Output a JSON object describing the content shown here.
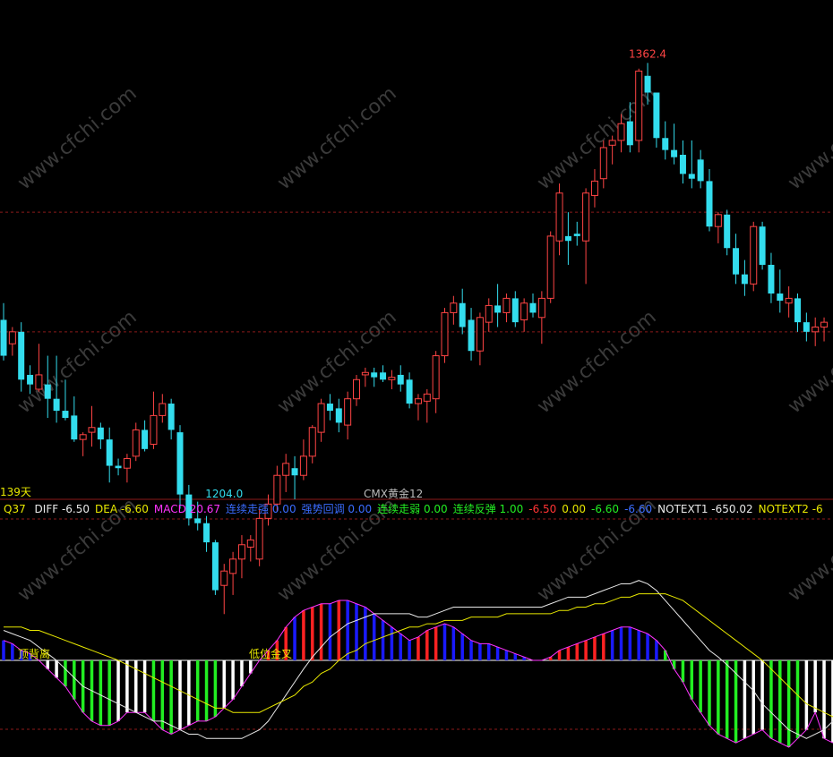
{
  "chart_data": {
    "type": "candlestick_macd",
    "instrument": "CMX黄金12",
    "days_label": "139天",
    "high_label": "1362.4",
    "low_label": "1204.0",
    "price_ylim": [
      1200,
      1370
    ],
    "price_gridlines": [
      1300,
      1250
    ],
    "candles": [
      {
        "o": 1255,
        "h": 1262,
        "l": 1238,
        "c": 1240
      },
      {
        "o": 1245,
        "h": 1252,
        "l": 1240,
        "c": 1250
      },
      {
        "o": 1250,
        "h": 1254,
        "l": 1225,
        "c": 1230
      },
      {
        "o": 1232,
        "h": 1236,
        "l": 1224,
        "c": 1228
      },
      {
        "o": 1226,
        "h": 1245,
        "l": 1225,
        "c": 1232
      },
      {
        "o": 1228,
        "h": 1240,
        "l": 1214,
        "c": 1222
      },
      {
        "o": 1222,
        "h": 1240,
        "l": 1212,
        "c": 1217
      },
      {
        "o": 1217,
        "h": 1230,
        "l": 1213,
        "c": 1214
      },
      {
        "o": 1215,
        "h": 1223,
        "l": 1204,
        "c": 1205
      },
      {
        "o": 1205,
        "h": 1208,
        "l": 1198,
        "c": 1207
      },
      {
        "o": 1208,
        "h": 1219,
        "l": 1202,
        "c": 1210
      },
      {
        "o": 1210,
        "h": 1212,
        "l": 1201,
        "c": 1205
      },
      {
        "o": 1205,
        "h": 1210,
        "l": 1187,
        "c": 1194
      },
      {
        "o": 1194,
        "h": 1197,
        "l": 1190,
        "c": 1193
      },
      {
        "o": 1193,
        "h": 1199,
        "l": 1187,
        "c": 1197
      },
      {
        "o": 1198,
        "h": 1212,
        "l": 1196,
        "c": 1209
      },
      {
        "o": 1209,
        "h": 1213,
        "l": 1200,
        "c": 1201
      },
      {
        "o": 1203,
        "h": 1225,
        "l": 1201,
        "c": 1215
      },
      {
        "o": 1215,
        "h": 1224,
        "l": 1212,
        "c": 1220
      },
      {
        "o": 1220,
        "h": 1222,
        "l": 1205,
        "c": 1209
      },
      {
        "o": 1208,
        "h": 1211,
        "l": 1176,
        "c": 1182
      },
      {
        "o": 1182,
        "h": 1186,
        "l": 1169,
        "c": 1172
      },
      {
        "o": 1172,
        "h": 1179,
        "l": 1167,
        "c": 1170
      },
      {
        "o": 1170,
        "h": 1173,
        "l": 1158,
        "c": 1162
      },
      {
        "o": 1162,
        "h": 1163,
        "l": 1140,
        "c": 1142
      },
      {
        "o": 1144,
        "h": 1153,
        "l": 1132,
        "c": 1150
      },
      {
        "o": 1149,
        "h": 1158,
        "l": 1140,
        "c": 1155
      },
      {
        "o": 1155,
        "h": 1165,
        "l": 1147,
        "c": 1161
      },
      {
        "o": 1160,
        "h": 1165,
        "l": 1154,
        "c": 1163
      },
      {
        "o": 1155,
        "h": 1176,
        "l": 1152,
        "c": 1172
      },
      {
        "o": 1172,
        "h": 1182,
        "l": 1169,
        "c": 1178
      },
      {
        "o": 1178,
        "h": 1194,
        "l": 1175,
        "c": 1190
      },
      {
        "o": 1190,
        "h": 1199,
        "l": 1183,
        "c": 1195
      },
      {
        "o": 1193,
        "h": 1198,
        "l": 1180,
        "c": 1190
      },
      {
        "o": 1190,
        "h": 1205,
        "l": 1188,
        "c": 1198
      },
      {
        "o": 1198,
        "h": 1211,
        "l": 1195,
        "c": 1210
      },
      {
        "o": 1208,
        "h": 1222,
        "l": 1204,
        "c": 1220
      },
      {
        "o": 1220,
        "h": 1224,
        "l": 1213,
        "c": 1217
      },
      {
        "o": 1218,
        "h": 1222,
        "l": 1208,
        "c": 1212
      },
      {
        "o": 1211,
        "h": 1225,
        "l": 1205,
        "c": 1222
      },
      {
        "o": 1222,
        "h": 1232,
        "l": 1219,
        "c": 1230
      },
      {
        "o": 1232,
        "h": 1235,
        "l": 1227,
        "c": 1233
      },
      {
        "o": 1233,
        "h": 1235,
        "l": 1227,
        "c": 1231
      },
      {
        "o": 1233,
        "h": 1236,
        "l": 1229,
        "c": 1230
      },
      {
        "o": 1230,
        "h": 1234,
        "l": 1226,
        "c": 1231
      },
      {
        "o": 1232,
        "h": 1236,
        "l": 1225,
        "c": 1228
      },
      {
        "o": 1230,
        "h": 1233,
        "l": 1218,
        "c": 1220
      },
      {
        "o": 1220,
        "h": 1224,
        "l": 1213,
        "c": 1222
      },
      {
        "o": 1221,
        "h": 1226,
        "l": 1212,
        "c": 1224
      },
      {
        "o": 1222,
        "h": 1242,
        "l": 1216,
        "c": 1240
      },
      {
        "o": 1240,
        "h": 1260,
        "l": 1237,
        "c": 1258
      },
      {
        "o": 1258,
        "h": 1265,
        "l": 1253,
        "c": 1262
      },
      {
        "o": 1262,
        "h": 1268,
        "l": 1249,
        "c": 1252
      },
      {
        "o": 1255,
        "h": 1260,
        "l": 1238,
        "c": 1242
      },
      {
        "o": 1242,
        "h": 1258,
        "l": 1236,
        "c": 1256
      },
      {
        "o": 1254,
        "h": 1264,
        "l": 1250,
        "c": 1261
      },
      {
        "o": 1261,
        "h": 1270,
        "l": 1252,
        "c": 1258
      },
      {
        "o": 1258,
        "h": 1266,
        "l": 1254,
        "c": 1264
      },
      {
        "o": 1264,
        "h": 1267,
        "l": 1252,
        "c": 1254
      },
      {
        "o": 1255,
        "h": 1264,
        "l": 1250,
        "c": 1262
      },
      {
        "o": 1262,
        "h": 1266,
        "l": 1256,
        "c": 1258
      },
      {
        "o": 1256,
        "h": 1267,
        "l": 1245,
        "c": 1264
      },
      {
        "o": 1264,
        "h": 1292,
        "l": 1262,
        "c": 1290
      },
      {
        "o": 1288,
        "h": 1312,
        "l": 1282,
        "c": 1308
      },
      {
        "o": 1290,
        "h": 1300,
        "l": 1278,
        "c": 1288
      },
      {
        "o": 1291,
        "h": 1296,
        "l": 1286,
        "c": 1290
      },
      {
        "o": 1288,
        "h": 1310,
        "l": 1270,
        "c": 1308
      },
      {
        "o": 1307,
        "h": 1318,
        "l": 1302,
        "c": 1313
      },
      {
        "o": 1314,
        "h": 1330,
        "l": 1310,
        "c": 1327
      },
      {
        "o": 1328,
        "h": 1332,
        "l": 1320,
        "c": 1330
      },
      {
        "o": 1330,
        "h": 1341,
        "l": 1325,
        "c": 1337
      },
      {
        "o": 1338,
        "h": 1346,
        "l": 1325,
        "c": 1328
      },
      {
        "o": 1330,
        "h": 1360,
        "l": 1325,
        "c": 1359
      },
      {
        "o": 1357,
        "h": 1362.4,
        "l": 1345,
        "c": 1350
      },
      {
        "o": 1350,
        "h": 1348,
        "l": 1327,
        "c": 1331
      },
      {
        "o": 1331,
        "h": 1338,
        "l": 1322,
        "c": 1326
      },
      {
        "o": 1326,
        "h": 1337,
        "l": 1320,
        "c": 1323
      },
      {
        "o": 1324,
        "h": 1330,
        "l": 1312,
        "c": 1316
      },
      {
        "o": 1316,
        "h": 1330,
        "l": 1310,
        "c": 1314
      },
      {
        "o": 1322,
        "h": 1326,
        "l": 1310,
        "c": 1313
      },
      {
        "o": 1313,
        "h": 1318,
        "l": 1292,
        "c": 1294
      },
      {
        "o": 1294,
        "h": 1300,
        "l": 1287,
        "c": 1299
      },
      {
        "o": 1299,
        "h": 1301,
        "l": 1282,
        "c": 1285
      },
      {
        "o": 1285,
        "h": 1291,
        "l": 1270,
        "c": 1274
      },
      {
        "o": 1274,
        "h": 1280,
        "l": 1265,
        "c": 1270
      },
      {
        "o": 1270,
        "h": 1296,
        "l": 1267,
        "c": 1294
      },
      {
        "o": 1294,
        "h": 1296,
        "l": 1276,
        "c": 1278
      },
      {
        "o": 1278,
        "h": 1283,
        "l": 1262,
        "c": 1266
      },
      {
        "o": 1266,
        "h": 1276,
        "l": 1258,
        "c": 1263
      },
      {
        "o": 1262,
        "h": 1269,
        "l": 1256,
        "c": 1264
      },
      {
        "o": 1264,
        "h": 1266,
        "l": 1250,
        "c": 1254
      },
      {
        "o": 1254,
        "h": 1258,
        "l": 1246,
        "c": 1250
      },
      {
        "o": 1250,
        "h": 1256,
        "l": 1244,
        "c": 1252
      },
      {
        "o": 1252,
        "h": 1256,
        "l": 1246,
        "c": 1254
      }
    ],
    "indicator": {
      "name": "Q37",
      "ylim": [
        -20,
        25
      ],
      "zero_label_left": "顶背离",
      "zero_label_mid": "低位金叉",
      "legend": [
        {
          "text": "DIFF -6.50",
          "color": "#e8e8e8"
        },
        {
          "text": "DEA -6.60",
          "color": "#e8e800"
        },
        {
          "text": "MACD 20.67",
          "color": "#ff33ff"
        },
        {
          "text": "连续走强 0.00",
          "color": "#3a6cff"
        },
        {
          "text": "强势回调 0.00",
          "color": "#3a6cff"
        },
        {
          "text": "连续走弱 0.00",
          "color": "#22ee22"
        },
        {
          "text": "连续反弹 1.00",
          "color": "#22ee22"
        },
        {
          "text": "-6.50",
          "color": "#ff3333"
        },
        {
          "text": "0.00",
          "color": "#e8e800"
        },
        {
          "text": "-6.60",
          "color": "#22ee22"
        },
        {
          "text": "-6.60",
          "color": "#3a6cff"
        },
        {
          "text": "NOTEXT1 -650.02",
          "color": "#e8e8e8"
        },
        {
          "text": "NOTEXT2 -6",
          "color": "#e8e800"
        }
      ],
      "diff": [
        9,
        8,
        7,
        6,
        4,
        2,
        0,
        -2,
        -4,
        -6,
        -7,
        -8,
        -9,
        -10,
        -11,
        -12,
        -13,
        -14,
        -14,
        -15,
        -16,
        -17,
        -17,
        -18,
        -18,
        -18,
        -18,
        -18,
        -17,
        -16,
        -14,
        -11,
        -8,
        -5,
        -2,
        1,
        4,
        7,
        9,
        11,
        12,
        13,
        14,
        14,
        14,
        14,
        14,
        13,
        13,
        14,
        15,
        16,
        16,
        16,
        16,
        16,
        16,
        16,
        16,
        16,
        16,
        16,
        17,
        18,
        19,
        19,
        19,
        20,
        21,
        22,
        23,
        23,
        24,
        23,
        21,
        18,
        15,
        12,
        9,
        6,
        3,
        1,
        -1,
        -3,
        -5,
        -7,
        -10,
        -12,
        -14,
        -16,
        -17,
        -18,
        -17,
        -16,
        -14
      ],
      "dea": [
        10,
        10,
        10,
        9,
        9,
        8,
        7,
        6,
        5,
        4,
        3,
        2,
        1,
        0,
        -1,
        -2,
        -3,
        -4,
        -5,
        -6,
        -7,
        -8,
        -9,
        -10,
        -11,
        -11,
        -12,
        -12,
        -12,
        -12,
        -11,
        -10,
        -9,
        -8,
        -6,
        -5,
        -3,
        -2,
        0,
        2,
        3,
        5,
        6,
        7,
        8,
        9,
        10,
        10,
        11,
        11,
        12,
        12,
        12,
        13,
        13,
        13,
        13,
        14,
        14,
        14,
        14,
        14,
        14,
        15,
        15,
        16,
        16,
        17,
        17,
        18,
        19,
        19,
        20,
        20,
        20,
        20,
        19,
        18,
        16,
        14,
        12,
        10,
        8,
        6,
        4,
        2,
        0,
        -2,
        -4,
        -6,
        -8,
        -10,
        -11,
        -12,
        -13
      ],
      "macd": [
        6,
        5,
        3,
        2,
        0,
        -2,
        -4,
        -6,
        -9,
        -12,
        -14,
        -15,
        -15,
        -14,
        -12,
        -12,
        -12,
        -14,
        -16,
        -17,
        -16,
        -15,
        -14,
        -14,
        -13,
        -11,
        -9,
        -6,
        -3,
        0,
        3,
        6,
        10,
        13,
        15,
        16,
        17,
        17,
        18,
        18,
        17,
        16,
        14,
        12,
        10,
        8,
        6,
        7,
        9,
        10,
        11,
        10,
        8,
        6,
        5,
        5,
        4,
        3,
        2,
        1,
        0,
        0,
        1,
        3,
        4,
        5,
        6,
        7,
        8,
        9,
        10,
        10,
        9,
        8,
        6,
        3,
        -2,
        -5,
        -9,
        -12,
        -15,
        -17,
        -18,
        -19,
        -18,
        -17,
        -16,
        -18,
        -19,
        -20,
        -18,
        -16,
        -12,
        -18,
        -19
      ],
      "macd_colors": [
        "b",
        "b",
        "b",
        "b",
        "b",
        "w",
        "w",
        "g",
        "g",
        "g",
        "g",
        "g",
        "g",
        "w",
        "w",
        "w",
        "w",
        "g",
        "g",
        "g",
        "w",
        "w",
        "g",
        "g",
        "g",
        "w",
        "w",
        "w",
        "w",
        "r",
        "r",
        "r",
        "r",
        "b",
        "r",
        "r",
        "r",
        "b",
        "r",
        "b",
        "b",
        "b",
        "b",
        "b",
        "b",
        "b",
        "b",
        "r",
        "r",
        "r",
        "b",
        "b",
        "b",
        "b",
        "b",
        "b",
        "b",
        "b",
        "b",
        "b",
        "b",
        "b",
        "r",
        "r",
        "r",
        "r",
        "r",
        "r",
        "r",
        "b",
        "b",
        "b",
        "b",
        "b",
        "b",
        "g",
        "g",
        "g",
        "g",
        "g",
        "g",
        "g",
        "g",
        "g",
        "w",
        "w",
        "w",
        "g",
        "g",
        "g",
        "g",
        "w",
        "w",
        "w",
        "w"
      ]
    }
  }
}
